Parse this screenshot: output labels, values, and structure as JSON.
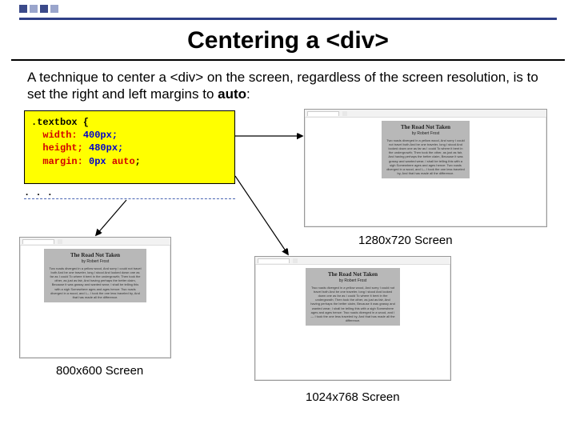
{
  "slide": {
    "title": "Centering a <div>",
    "intro_prefix": "A technique to center a <div> on the screen, regardless of the screen resolution, is to set the right and left margins to ",
    "intro_bold": "auto",
    "intro_suffix": ":"
  },
  "code": {
    "selector": ".textbox {",
    "prop1": "width:",
    "val1": "400px;",
    "prop2": "height;",
    "val2": "480px;",
    "prop3": "margin:",
    "val3a": "0px",
    "val3b": "auto",
    "val3c": ";",
    "dots": ". . ."
  },
  "poem": {
    "title": "The Road Not Taken",
    "author": "by Robert Frost",
    "body": "Two roads diverged in a yellow wood,\nAnd sorry I could not travel both\nAnd be one traveler, long I stood\nAnd looked down one as far as I could\nTo where it bent in the undergrowth;\n\nThen took the other, as just as fair,\nAnd having perhaps the better claim,\nBecause it was grassy and wanted wear;\n\nI shall be telling this with a sigh\nSomewhere ages and ages hence:\nTwo roads diverged in a wood, and I—\nI took the one less traveled by,\nAnd that has made all the difference."
  },
  "captions": {
    "large": "1280x720 Screen",
    "small": "800x600 Screen",
    "med": "1024x768 Screen"
  }
}
